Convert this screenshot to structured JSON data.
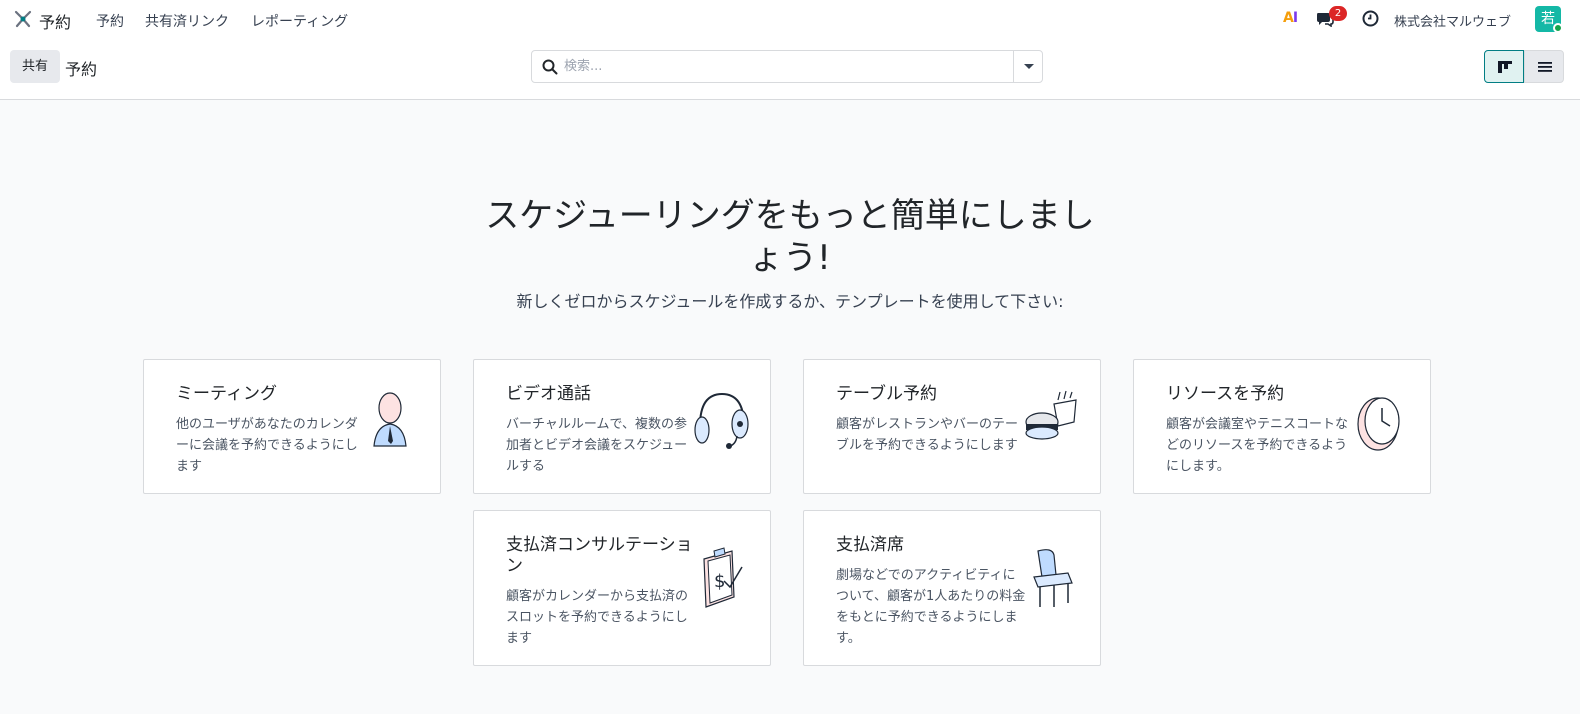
{
  "nav": {
    "app_name": "予約",
    "menu": [
      "予約",
      "共有済リンク",
      "レポーティング"
    ],
    "ai_label": "AI",
    "chat_badge": "2",
    "company": "株式会社マルウェブ",
    "avatar_initial": "若"
  },
  "control": {
    "share_label": "共有",
    "breadcrumb": "予約",
    "search_placeholder": "検索..."
  },
  "helper": {
    "headline": "スケジューリングをもっと簡単にしましょう!",
    "subline": "新しくゼロからスケジュールを作成するか、テンプレートを使用して下さい:"
  },
  "templates": [
    {
      "title": "ミーティング",
      "desc": "他のユーザがあなたのカレンダーに会議を予約できるようにします",
      "icon": "person-icon"
    },
    {
      "title": "ビデオ通話",
      "desc": "バーチャルルームで、複数の参加者とビデオ会議をスケジュールする",
      "icon": "headset-icon"
    },
    {
      "title": "テーブル予約",
      "desc": "顧客がレストランやバーのテーブルを予約できるようにします",
      "icon": "burger-icon"
    },
    {
      "title": "リソースを予約",
      "desc": "顧客が会議室やテニスコートなどのリソースを予約できるようにします。",
      "icon": "clock-icon"
    },
    {
      "title": "支払済コンサルテーション",
      "desc": "顧客がカレンダーから支払済のスロットを予約できるようにします",
      "icon": "clipboard-dollar-icon"
    },
    {
      "title": "支払済席",
      "desc": "劇場などでのアクティビティについて、顧客が1人あたりの料金をもとに予約できるようにします。",
      "icon": "chair-icon"
    }
  ],
  "colors": {
    "accent": "#017e84",
    "badge": "#dc2626",
    "avatar": "#14b8a6"
  }
}
